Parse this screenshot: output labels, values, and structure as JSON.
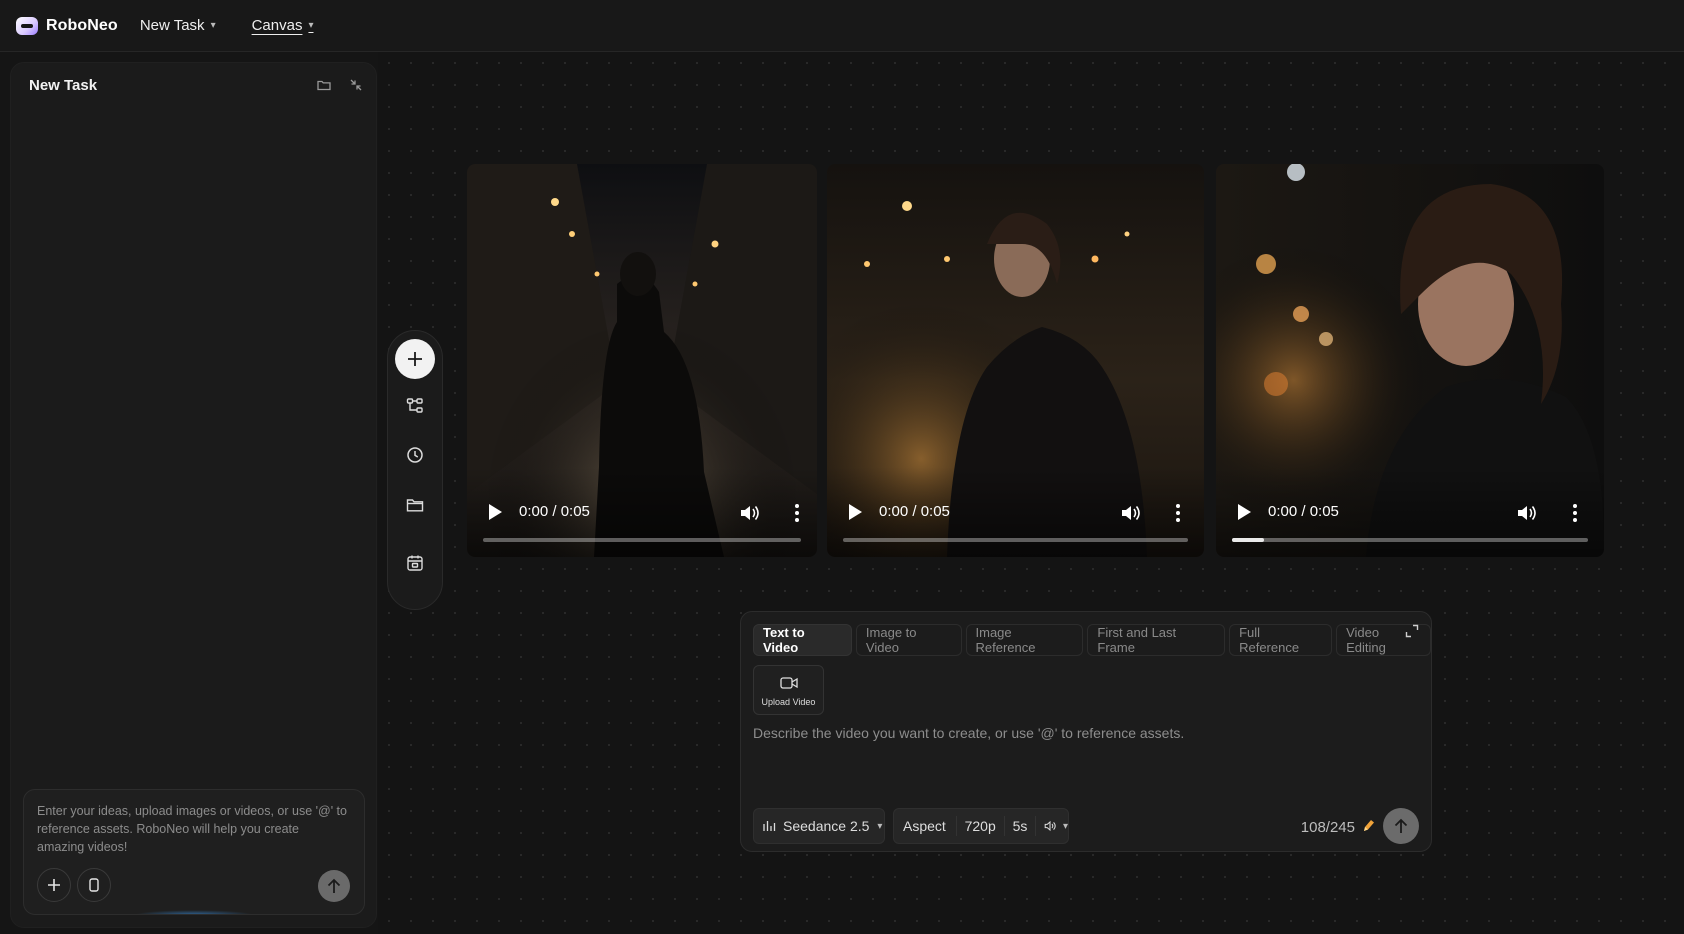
{
  "header": {
    "brand": "RoboNeo",
    "new_task_label": "New Task",
    "canvas_label": "Canvas"
  },
  "left_panel": {
    "title": "New Task",
    "composer_placeholder": "Enter your ideas, upload images or videos, or use '@' to reference assets. RoboNeo will help you create amazing videos!"
  },
  "toolbar": {
    "icons": [
      "plus-icon",
      "workflow-icon",
      "history-icon",
      "folder-icon",
      "calendar-icon"
    ]
  },
  "videos": [
    {
      "time": "0:00 / 0:05",
      "progress": 0.0
    },
    {
      "time": "0:00 / 0:05",
      "progress": 0.0
    },
    {
      "time": "0:00 / 0:05",
      "progress": 0.09
    }
  ],
  "prompt_panel": {
    "tabs": [
      "Text to Video",
      "Image to Video",
      "Image Reference",
      "First and Last Frame",
      "Full Reference",
      "Video Editing"
    ],
    "active_tab": "Text to Video",
    "upload_label": "Upload Video",
    "placeholder": "Describe the video you want to create, or use '@' to reference assets.",
    "model": "Seedance 2.5",
    "aspect_label": "Aspect",
    "resolution": "720p",
    "duration": "5s",
    "credits": "108/245"
  },
  "colors": {
    "background": "#151515",
    "panel": "#1c1c1c",
    "accent_pencil": "#f0a33a"
  }
}
